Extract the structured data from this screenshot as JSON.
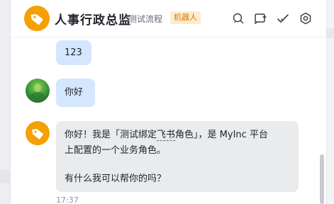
{
  "header": {
    "title": "人事行政总监",
    "subtitle": "测试流程",
    "badge": "机器人",
    "icons": [
      "search-icon",
      "add-window-icon",
      "check-icon",
      "settings-icon"
    ]
  },
  "messages": [
    {
      "sender": "user",
      "text": "123"
    },
    {
      "sender": "user",
      "text": "你好"
    },
    {
      "sender": "bot",
      "line1_pre": "你好！我是「测试绑定",
      "line1_link": "飞书",
      "line1_post": "角色」，是 MyInc 平台",
      "line2": "上配置的一个业务角色。",
      "line3": "有什么我可以帮你的吗？",
      "time": "17:37"
    }
  ],
  "colors": {
    "brand": "#f5a000",
    "user_bubble": "#d5e7fe",
    "bot_bubble": "#eaebed",
    "badge_bg": "#fdebd0",
    "badge_text": "#d97a00"
  }
}
